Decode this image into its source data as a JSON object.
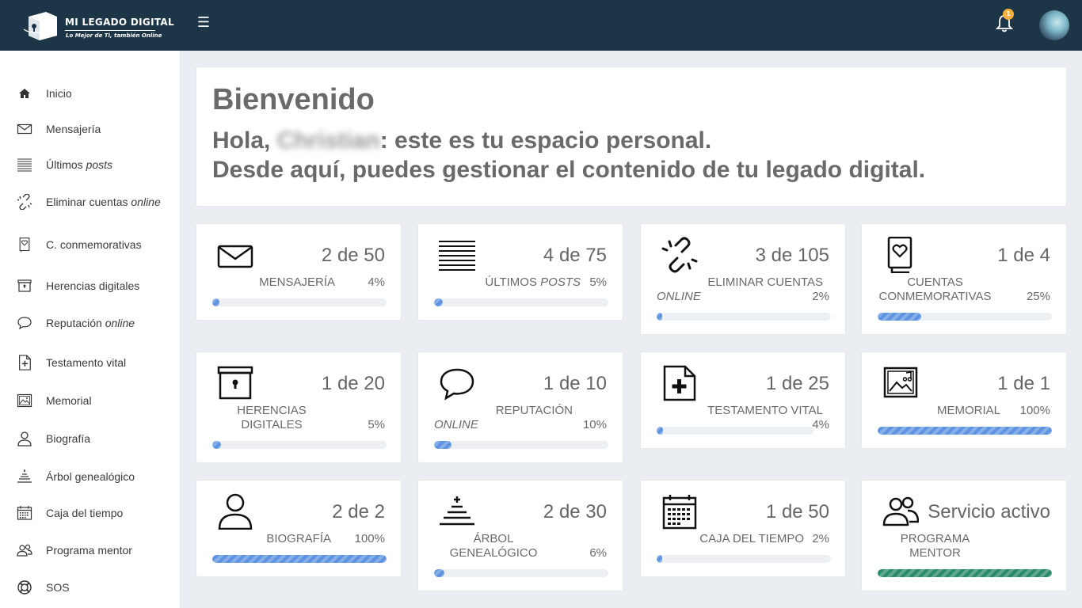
{
  "header": {
    "logo_title": "MI LEGADO DIGITAL",
    "logo_subtitle": "Lo Mejor de Ti, también Online",
    "notification_count": "1"
  },
  "sidebar": {
    "items": [
      {
        "label": "Inicio",
        "italic": ""
      },
      {
        "label": "Mensajería",
        "italic": ""
      },
      {
        "label": "Últimos ",
        "italic": "posts"
      },
      {
        "label": "Eliminar cuentas ",
        "italic": "online"
      },
      {
        "label": "C. conmemorativas",
        "italic": ""
      },
      {
        "label": "Herencias digitales",
        "italic": ""
      },
      {
        "label": "Reputación ",
        "italic": "online"
      },
      {
        "label": "Testamento vital",
        "italic": ""
      },
      {
        "label": "Memorial",
        "italic": ""
      },
      {
        "label": "Biografía",
        "italic": ""
      },
      {
        "label": "Árbol genealógico",
        "italic": ""
      },
      {
        "label": "Caja del tiempo",
        "italic": ""
      },
      {
        "label": "Programa mentor",
        "italic": ""
      },
      {
        "label": "SOS",
        "italic": ""
      }
    ]
  },
  "welcome": {
    "title": "Bienvenido",
    "greeting_prefix": "Hola, ",
    "user_name": "Christian",
    "greeting_suffix": ": este es tu espacio personal.",
    "line2": "Desde aquí, puedes gestionar el contenido de tu legado digital."
  },
  "cards": [
    {
      "value": "2 de 50",
      "label": "MENSAJERÍA",
      "label_italic": "",
      "pct": "4%",
      "progress": 4
    },
    {
      "value": "4 de 75",
      "label": "ÚLTIMOS ",
      "label_italic": "POSTS",
      "pct": "5%",
      "progress": 5
    },
    {
      "value": "3 de 105",
      "label": "ELIMINAR CUENTAS ",
      "label_italic": "ONLINE",
      "pct": "2%",
      "progress": 2
    },
    {
      "value": "1 de 4",
      "label": "CUENTAS CONMEMORATIVAS",
      "label_italic": "",
      "pct": "25%",
      "progress": 25
    },
    {
      "value": "1 de 20",
      "label": "HERENCIAS DIGITALES",
      "label_italic": "",
      "pct": "5%",
      "progress": 5
    },
    {
      "value": "1 de 10",
      "label": "REPUTACIÓN ",
      "label_italic": "ONLINE",
      "pct": "10%",
      "progress": 10
    },
    {
      "value": "1 de 25",
      "label": "TESTAMENTO VITAL",
      "label_italic": "",
      "pct": "4%",
      "progress": 4
    },
    {
      "value": "1 de 1",
      "label": "MEMORIAL",
      "label_italic": "",
      "pct": "100%",
      "progress": 100
    },
    {
      "value": "2 de 2",
      "label": "BIOGRAFÍA",
      "label_italic": "",
      "pct": "100%",
      "progress": 100
    },
    {
      "value": "2 de 30",
      "label": "ÁRBOL GENEALÓGICO",
      "label_italic": "",
      "pct": "6%",
      "progress": 6
    },
    {
      "value": "1 de 50",
      "label": "CAJA DEL TIEMPO",
      "label_italic": "",
      "pct": "2%",
      "progress": 2
    },
    {
      "value": "Servicio activo",
      "label": "PROGRAMA MENTOR",
      "label_italic": "",
      "pct": "",
      "progress": 100
    }
  ],
  "colors": {
    "header_bg": "#1c3547",
    "progress_blue": "#5d93e1",
    "progress_green": "#2a8a6c",
    "badge": "#f5b13b"
  }
}
